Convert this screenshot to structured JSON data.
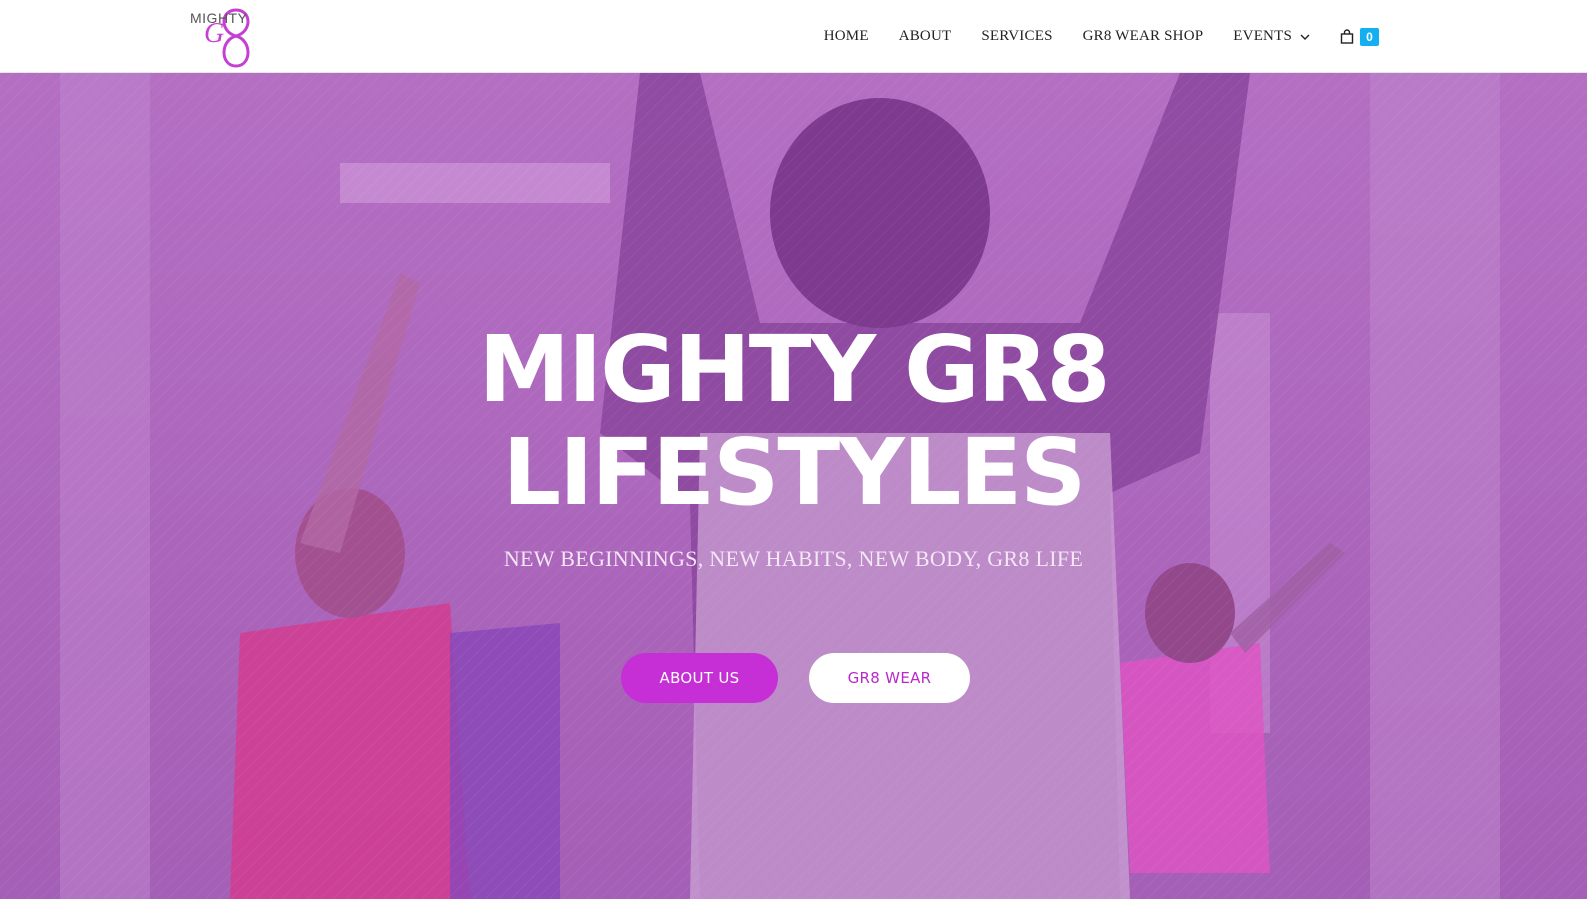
{
  "header": {
    "logo_text": "MIGHTY",
    "nav": [
      "HOME",
      "ABOUT",
      "SERVICES",
      "GR8 WEAR SHOP",
      "EVENTS"
    ],
    "cart_count": "0"
  },
  "hero": {
    "title_line1": "MIGHTY GR8",
    "title_line2": "LIFESTYLES",
    "subtitle": "NEW BEGINNINGS, NEW HABITS, NEW BODY, GR8 LIFE",
    "button_about": "ABOUT US",
    "button_wear": "GR8 WEAR"
  },
  "colors": {
    "accent": "#c62fd6",
    "cart_badge": "#13aff0",
    "overlay": "#aa3cbe"
  }
}
